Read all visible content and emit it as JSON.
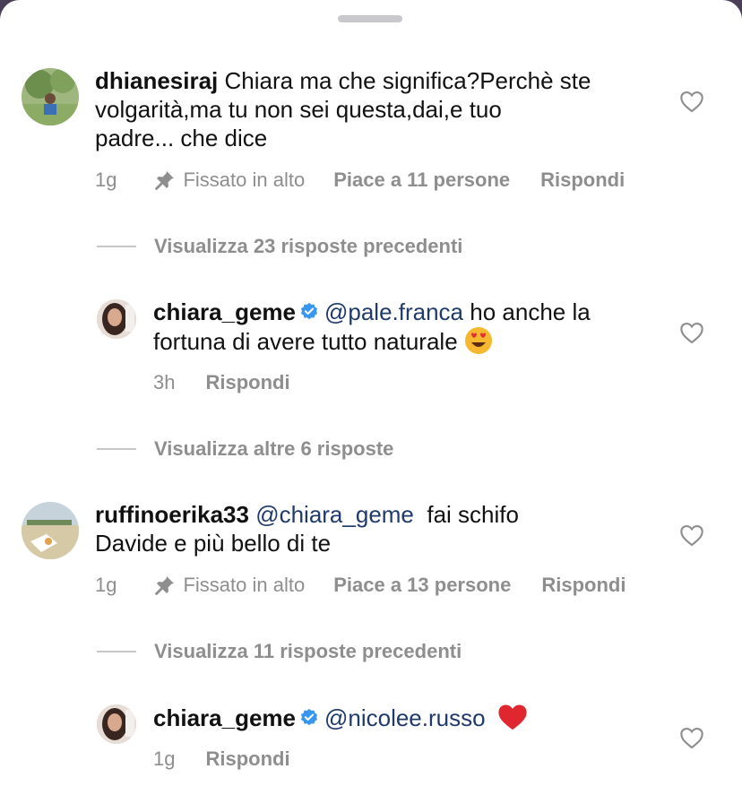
{
  "comments": [
    {
      "username": "dhianesiraj",
      "text_line1": "Chiara ma che significa?Perchè ste",
      "text_line2": "volgarità,ma tu non sei questa,dai,e tuo",
      "text_line3": "padre... che dice",
      "time": "1g",
      "pinned_label": "Fissato in alto",
      "likes": "Piace a 11 persone",
      "reply": "Rispondi",
      "view_replies": "Visualizza 23 risposte precedenti"
    },
    {
      "username": "chiara_geme",
      "mention": "@pale.franca",
      "text_after_mention": " ho anche la",
      "text_line2": "fortuna di avere tutto naturale",
      "emoji": "heart-eyes",
      "time": "3h",
      "reply": "Rispondi",
      "view_replies": "Visualizza altre 6 risposte"
    },
    {
      "username": "ruffinoerika33",
      "mention": "@chiara_geme",
      "text_after_mention": "  fai schifo",
      "text_line2": "Davide e più bello di te",
      "time": "1g",
      "pinned_label": "Fissato in alto",
      "likes": "Piace a 13 persone",
      "reply": "Rispondi",
      "view_replies": "Visualizza 11 risposte precedenti"
    },
    {
      "username": "chiara_geme",
      "mention": "@nicolee.russo",
      "emoji": "red-heart",
      "time": "1g",
      "reply": "Rispondi"
    }
  ],
  "colors": {
    "mention": "#1f3a6b",
    "meta": "#8e8e8e",
    "verified": "#3897f0",
    "backdrop": "#4b3f58"
  }
}
